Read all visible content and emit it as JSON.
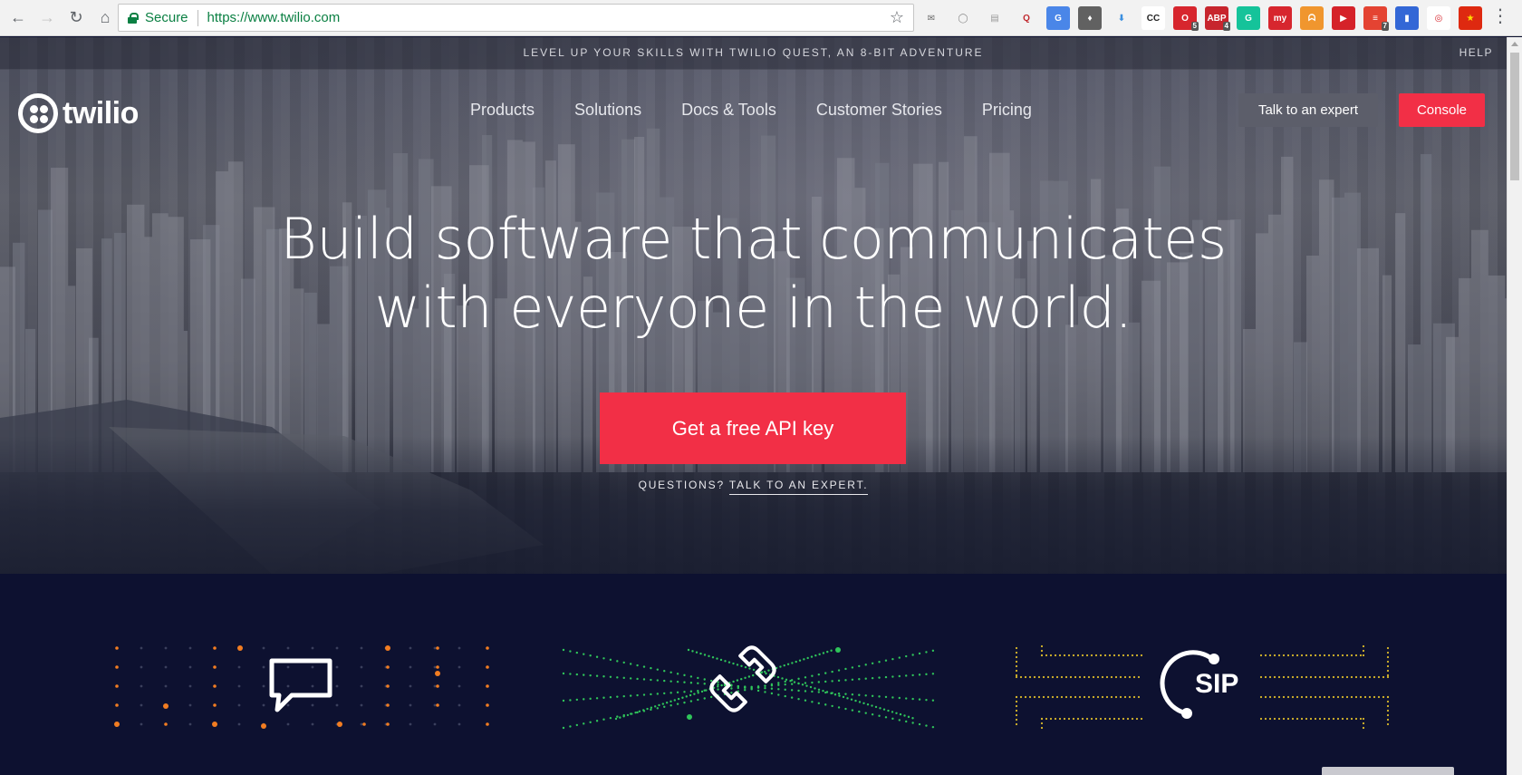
{
  "browser": {
    "secure_label": "Secure",
    "url": "https://www.twilio.com",
    "extensions": [
      {
        "icon": "mail-icon",
        "label": "✉",
        "color": "#6b6b6b",
        "bg": "transparent",
        "badge": ""
      },
      {
        "icon": "circle-icon",
        "label": "◯",
        "color": "#888888",
        "bg": "transparent",
        "badge": ""
      },
      {
        "icon": "pdf-icon",
        "label": "▤",
        "color": "#9a9a9a",
        "bg": "transparent",
        "badge": ""
      },
      {
        "icon": "quora-icon",
        "label": "Q",
        "color": "#c0282d",
        "bg": "transparent",
        "badge": ""
      },
      {
        "icon": "translate-icon",
        "label": "G",
        "color": "#ffffff",
        "bg": "#4a86e8",
        "badge": ""
      },
      {
        "icon": "bulb-icon",
        "label": "♦",
        "color": "#ffffff",
        "bg": "#616161",
        "badge": ""
      },
      {
        "icon": "download-icon",
        "label": "⬇",
        "color": "#3b8fe0",
        "bg": "transparent",
        "badge": ""
      },
      {
        "icon": "cc-icon",
        "label": "CC",
        "color": "#222222",
        "bg": "#ffffff",
        "badge": ""
      },
      {
        "icon": "opera-icon",
        "label": "O",
        "color": "#ffffff",
        "bg": "#d7262e",
        "badge": "5"
      },
      {
        "icon": "adblock-icon",
        "label": "ABP",
        "color": "#ffffff",
        "bg": "#c7252d",
        "badge": "4"
      },
      {
        "icon": "grammarly-icon",
        "label": "G",
        "color": "#ffffff",
        "bg": "#15c39a",
        "badge": ""
      },
      {
        "icon": "my-icon",
        "label": "my",
        "color": "#ffffff",
        "bg": "#d7262e",
        "badge": ""
      },
      {
        "icon": "orange-icon",
        "label": "ᗣ",
        "color": "#ffffff",
        "bg": "#f0962e",
        "badge": ""
      },
      {
        "icon": "play-icon",
        "label": "▶",
        "color": "#ffffff",
        "bg": "#d52229",
        "badge": ""
      },
      {
        "icon": "todoist-icon",
        "label": "≡",
        "color": "#ffffff",
        "bg": "#e44332",
        "badge": "7"
      },
      {
        "icon": "bookmark-icon",
        "label": "▮",
        "color": "#ffffff",
        "bg": "#3367d6",
        "badge": ""
      },
      {
        "icon": "ring-icon",
        "label": "◎",
        "color": "#d7262e",
        "bg": "#ffffff",
        "badge": ""
      },
      {
        "icon": "flag-icon",
        "label": "★",
        "color": "#ffde00",
        "bg": "#de2910",
        "badge": ""
      }
    ]
  },
  "banner": {
    "text": "LEVEL UP YOUR SKILLS WITH TWILIO QUEST, AN 8-BIT ADVENTURE",
    "help": "HELP"
  },
  "header": {
    "logo_text": "twilio",
    "nav": [
      "Products",
      "Solutions",
      "Docs & Tools",
      "Customer Stories",
      "Pricing"
    ],
    "talk_to_expert": "Talk to an expert",
    "console": "Console"
  },
  "hero": {
    "headline_line1": "Build software that communicates",
    "headline_line2": "with everyone in the world.",
    "cta": "Get a free API key",
    "questions_prefix": "QUESTIONS?",
    "questions_link": "TALK TO AN EXPERT."
  },
  "lower": {
    "sip_label": "SIP"
  },
  "colors": {
    "brand_red": "#f22f46",
    "dark_bg": "#0d1130",
    "dot_orange": "#f27d21",
    "dot_green": "#2fc45a",
    "dot_yellow": "#d9b92a"
  }
}
